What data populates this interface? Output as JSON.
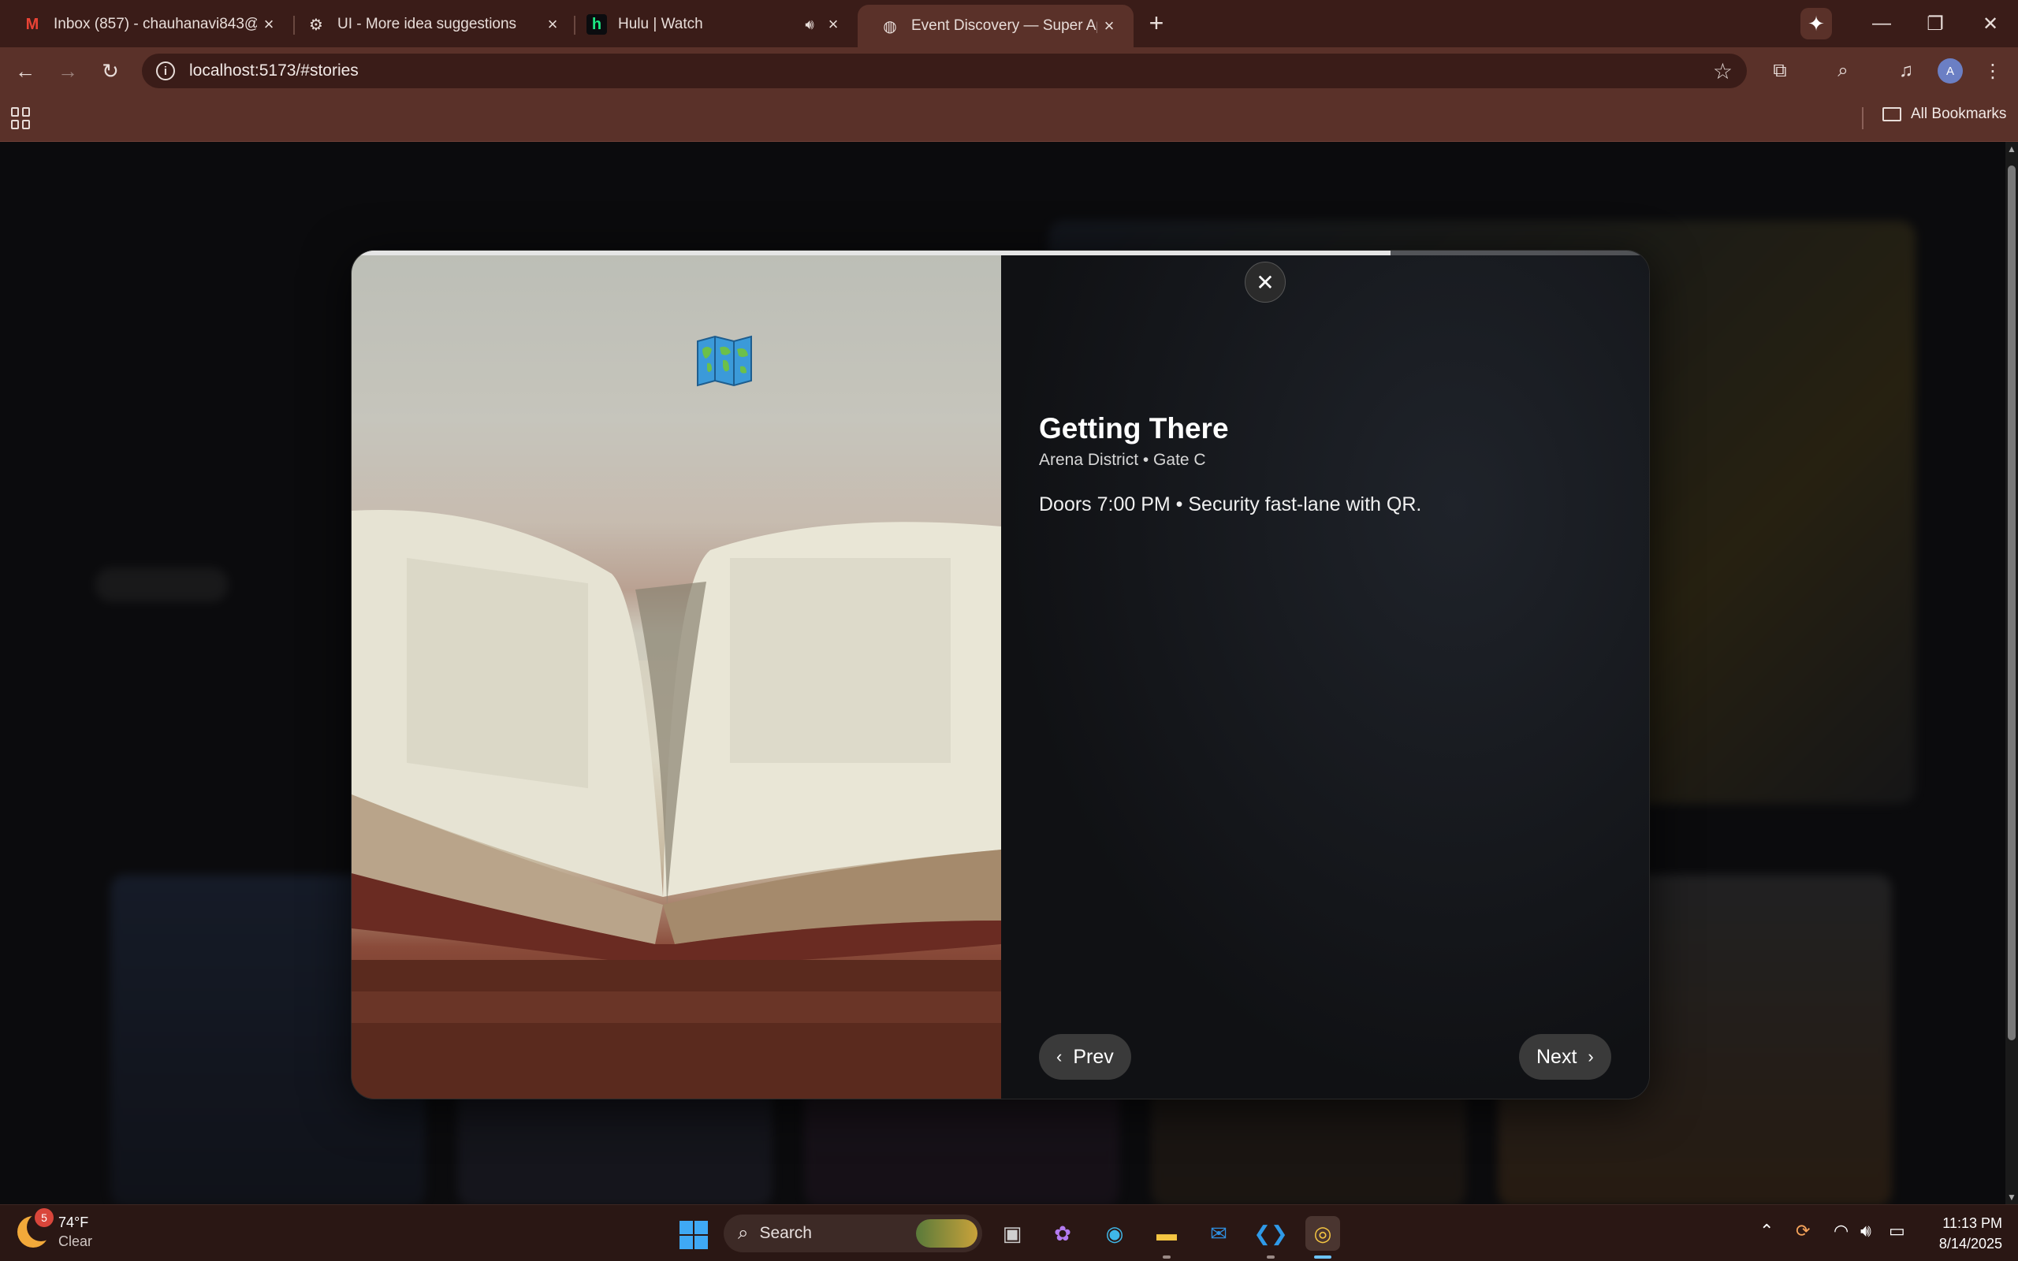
{
  "browser": {
    "tabs": [
      {
        "title": "Inbox (857) - chauhanavi843@",
        "favicon": "M"
      },
      {
        "title": "UI - More idea suggestions",
        "favicon": "⚙"
      },
      {
        "title": "Hulu | Watch",
        "favicon": "h"
      },
      {
        "title": "Event Discovery — Super App",
        "favicon": "◍",
        "active": true
      }
    ],
    "new_tab": "+",
    "url": "localhost:5173/#stories",
    "profile_initial": "A",
    "all_bookmarks": "All Bookmarks"
  },
  "story": {
    "progress": 0.8,
    "emoji": "world-map",
    "title": "Getting There",
    "subtitle": "Arena District • Gate C",
    "description": "Doors 7:00 PM • Security fast-lane with QR.",
    "prev_label": "Prev",
    "next_label": "Next",
    "close": "✕"
  },
  "taskbar": {
    "weather_temp": "74°F",
    "weather_cond": "Clear",
    "weather_badge": "5",
    "search_placeholder": "Search",
    "time": "11:13 PM",
    "date": "8/14/2025"
  }
}
